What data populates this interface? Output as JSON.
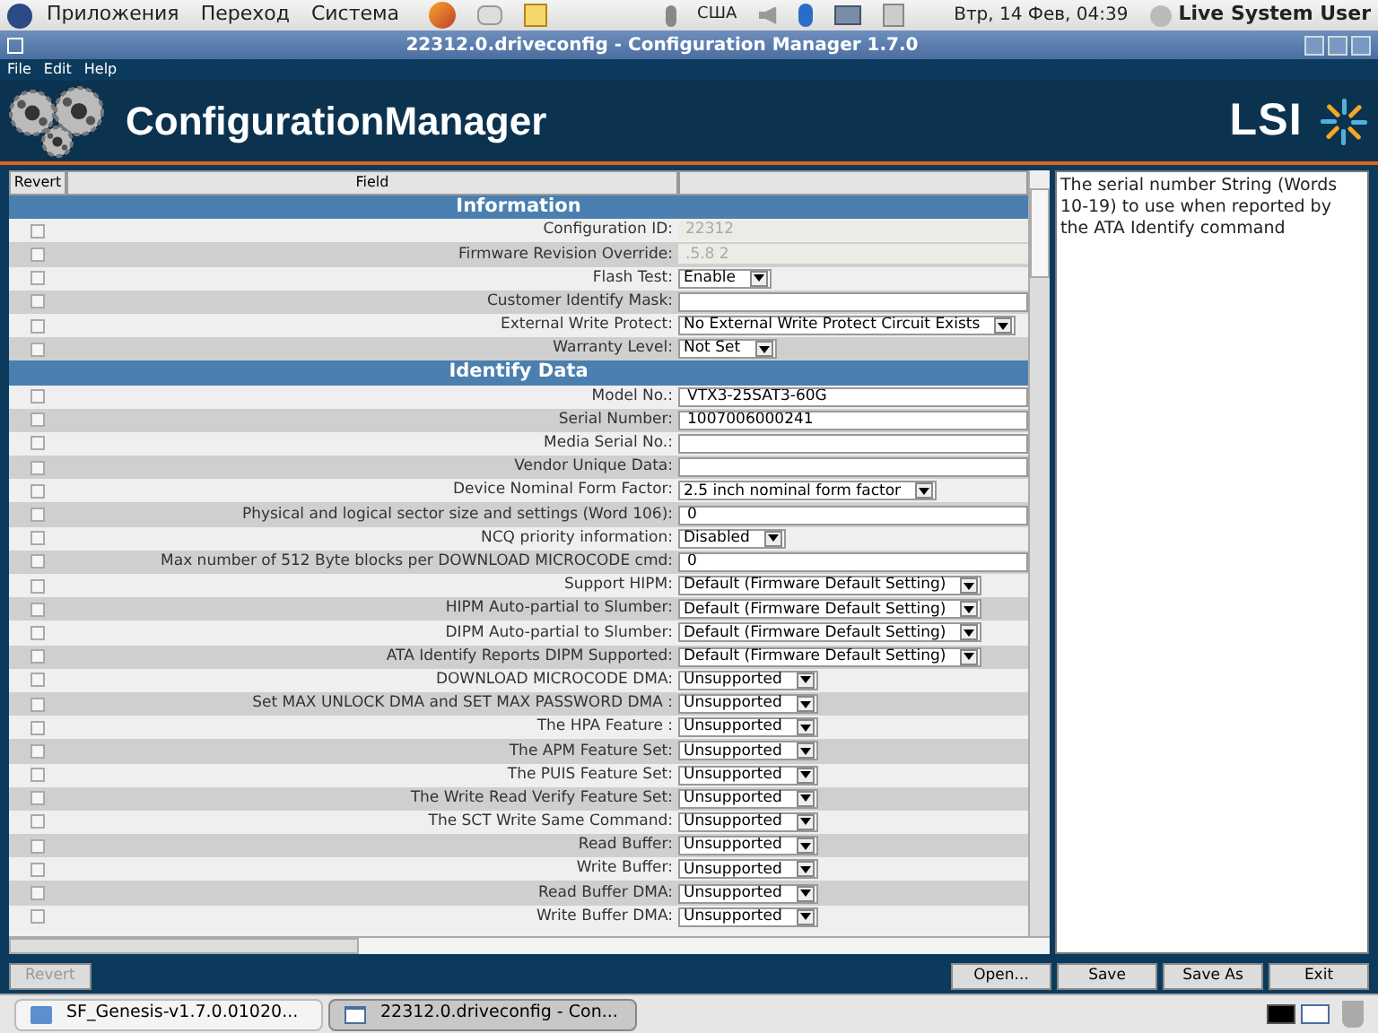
{
  "top_panel": {
    "menus": [
      "Приложения",
      "Переход",
      "Система"
    ],
    "keyboard_layout": "США",
    "clock": "Втр, 14 Фев, 04:39",
    "user": "Live System User"
  },
  "window": {
    "title": "22312.0.driveconfig - Configuration Manager 1.7.0",
    "menu": [
      "File",
      "Edit",
      "Help"
    ],
    "app_name": "ConfigurationManager",
    "logo_text": "LSI"
  },
  "table": {
    "columns": [
      "Revert",
      "Field"
    ],
    "sections": [
      {
        "title": "Information",
        "rows": [
          {
            "label": "Configuration ID:",
            "kind": "readonly",
            "value": "22312",
            "checked": false
          },
          {
            "label": "Firmware Revision Override:",
            "kind": "readonly",
            "value": ".5.8 2",
            "checked": false
          },
          {
            "label": "Flash Test:",
            "kind": "select",
            "value": "Enable",
            "checked": false
          },
          {
            "label": "Customer Identify Mask:",
            "kind": "text",
            "checked": false
          },
          {
            "label": "External Write Protect:",
            "kind": "select",
            "value": "No External Write Protect Circuit Exists",
            "checked": false
          },
          {
            "label": "Warranty Level:",
            "kind": "select",
            "value": "Not Set",
            "checked": false
          }
        ]
      },
      {
        "title": "Identify Data",
        "rows": [
          {
            "label": "Model No.:",
            "kind": "text",
            "value": "VTX3-25SAT3-60G",
            "checked": false
          },
          {
            "label": "Serial Number:",
            "kind": "text",
            "value": "1007006000241",
            "checked": false
          },
          {
            "label": "Media Serial No.:",
            "kind": "text",
            "checked": false
          },
          {
            "label": "Vendor Unique Data:",
            "kind": "text",
            "checked": false
          },
          {
            "label": "Device Nominal Form Factor:",
            "kind": "select",
            "value": "2.5 inch nominal form factor",
            "checked": false
          },
          {
            "label": "Physical and logical sector size and settings (Word 106):",
            "kind": "text",
            "value": "0",
            "checked": false
          },
          {
            "label": "NCQ priority information:",
            "kind": "select",
            "value": "Disabled",
            "checked": false
          },
          {
            "label": "Max number of 512 Byte blocks per DOWNLOAD MICROCODE cmd:",
            "kind": "text",
            "value": "0",
            "checked": false
          },
          {
            "label": "Support HIPM:",
            "kind": "select",
            "value": "Default (Firmware Default Setting)",
            "checked": false
          },
          {
            "label": "HIPM Auto-partial to Slumber:",
            "kind": "select",
            "value": "Default (Firmware Default Setting)",
            "checked": false
          },
          {
            "label": "DIPM Auto-partial to Slumber:",
            "kind": "select",
            "value": "Default (Firmware Default Setting)",
            "checked": false
          },
          {
            "label": "ATA Identify Reports DIPM Supported:",
            "kind": "select",
            "value": "Default (Firmware Default Setting)",
            "checked": false
          },
          {
            "label": "DOWNLOAD MICROCODE DMA:",
            "kind": "select",
            "value": "Unsupported",
            "checked": false
          },
          {
            "label": "Set MAX UNLOCK DMA and SET MAX PASSWORD DMA  :",
            "kind": "select",
            "value": "Unsupported",
            "checked": false
          },
          {
            "label": "The HPA Feature :",
            "kind": "select",
            "value": "Unsupported",
            "checked": false
          },
          {
            "label": "The APM Feature Set:",
            "kind": "select",
            "value": "Unsupported",
            "checked": false
          },
          {
            "label": "The PUIS Feature Set:",
            "kind": "select",
            "value": "Unsupported",
            "checked": false
          },
          {
            "label": "The Write Read Verify Feature Set:",
            "kind": "select",
            "value": "Unsupported",
            "checked": false
          },
          {
            "label": "The SCT Write Same Command:",
            "kind": "select",
            "value": "Unsupported",
            "checked": false
          },
          {
            "label": "Read Buffer:",
            "kind": "select",
            "value": "Unsupported",
            "checked": false
          },
          {
            "label": "Write Buffer:",
            "kind": "select",
            "value": "Unsupported",
            "checked": false
          },
          {
            "label": "Read Buffer DMA:",
            "kind": "select",
            "value": "Unsupported",
            "checked": false
          },
          {
            "label": "Write Buffer DMA:",
            "kind": "select",
            "value": "Unsupported",
            "checked": false
          }
        ]
      }
    ]
  },
  "help_text": "The serial number String (Words 10-19) to use when reported by the ATA Identify command",
  "buttons": [
    {
      "label": "Revert",
      "disabled": true
    },
    {
      "label": "Open...",
      "disabled": false
    },
    {
      "label": "Save",
      "disabled": false
    },
    {
      "label": "Save As",
      "disabled": false
    },
    {
      "label": "Exit",
      "disabled": false
    }
  ],
  "taskbar": [
    {
      "label": "SF_Genesis-v1.7.0.01020...",
      "kind": "folder",
      "selected": false
    },
    {
      "label": "22312.0.driveconfig - Con...",
      "kind": "window",
      "selected": true
    }
  ]
}
